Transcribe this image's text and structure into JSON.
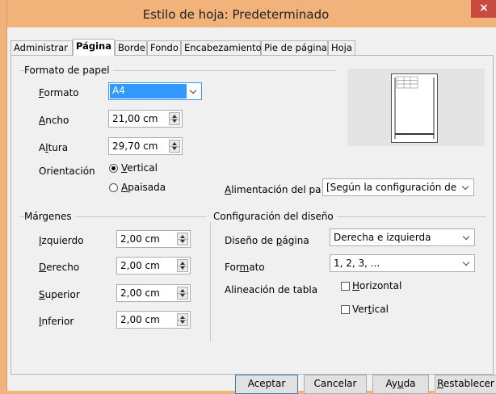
{
  "window": {
    "title": "Estilo de hoja: Predeterminado",
    "close_glyph": "×"
  },
  "tabs": [
    {
      "label": "Administrar",
      "active": false
    },
    {
      "label": "Página",
      "active": true
    },
    {
      "label": "Borde",
      "active": false
    },
    {
      "label": "Fondo",
      "active": false
    },
    {
      "label": "Encabezamiento",
      "active": false
    },
    {
      "label": "Pie de página",
      "active": false
    },
    {
      "label": "Hoja",
      "active": false
    }
  ],
  "paper": {
    "group_title": "Formato de papel",
    "format_label_u": "F",
    "format_label_rest": "ormato",
    "format_value": "A4",
    "width_label_u": "A",
    "width_label_rest": "ncho",
    "width_value": "21,00 cm",
    "height_label_pre": "A",
    "height_label_u": "l",
    "height_label_rest": "tura",
    "height_value": "29,70 cm",
    "orientation_label": "Orientación",
    "portrait_label_u": "V",
    "portrait_label_rest": "ertical",
    "portrait_selected": true,
    "landscape_label_u": "A",
    "landscape_label_rest": "paisada",
    "landscape_selected": false,
    "tray_label_u": "A",
    "tray_label_rest": "limentación del pap",
    "tray_value": "[Según la configuración de la i"
  },
  "margins": {
    "group_title": "Márgenes",
    "left_label_u": "I",
    "left_label_rest": "zquierdo",
    "left_value": "2,00 cm",
    "right_label_u": "D",
    "right_label_rest": "erecho",
    "right_value": "2,00 cm",
    "top_label_u": "S",
    "top_label_rest": "uperior",
    "top_value": "2,00 cm",
    "bottom_label_u": "I",
    "bottom_label_rest": "nferior",
    "bottom_value": "2,00 cm"
  },
  "layout": {
    "group_title": "Configuración del diseño",
    "page_layout_label_pre": "Diseño de ",
    "page_layout_label_u": "p",
    "page_layout_label_rest": "ágina",
    "page_layout_value": "Derecha e izquierda",
    "format_label_pre": "For",
    "format_label_u": "m",
    "format_label_rest": "ato",
    "format_value": "1, 2, 3, ...",
    "table_align_label": "Alineación de tabla",
    "horizontal_label_u": "H",
    "horizontal_label_rest": "orizontal",
    "horizontal_checked": false,
    "vertical_label_pre": "Ver",
    "vertical_label_u": "t",
    "vertical_label_rest": "ical",
    "vertical_checked": false
  },
  "buttons": {
    "ok": "Aceptar",
    "cancel": "Cancelar",
    "help_pre": "Ay",
    "help_u": "u",
    "help_rest": "da",
    "reset_u": "R",
    "reset_rest": "establecer"
  },
  "colors": {
    "titlebar": "#f2b37a",
    "close": "#c74b3f",
    "highlight": "#3399ff"
  }
}
